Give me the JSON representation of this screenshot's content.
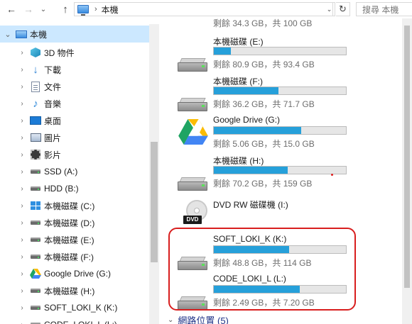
{
  "address": {
    "back_icon": "arrow-left",
    "fwd_icon": "arrow-right",
    "up_icon": "arrow-up",
    "crumb_sep": "›",
    "crumb": "本機",
    "search_placeholder": "搜尋 本機"
  },
  "nav": {
    "items": [
      {
        "label": "本機",
        "icon": "computer-icon",
        "expanded": true,
        "selected": true
      },
      {
        "label": "3D 物件",
        "icon": "3d-objects-icon"
      },
      {
        "label": "下載",
        "icon": "download-icon"
      },
      {
        "label": "文件",
        "icon": "document-icon"
      },
      {
        "label": "音樂",
        "icon": "music-icon"
      },
      {
        "label": "桌面",
        "icon": "desktop-icon"
      },
      {
        "label": "圖片",
        "icon": "pictures-icon"
      },
      {
        "label": "影片",
        "icon": "videos-icon"
      },
      {
        "label": "SSD (A:)",
        "icon": "drive-icon"
      },
      {
        "label": "HDD (B:)",
        "icon": "drive-icon"
      },
      {
        "label": "本機磁碟 (C:)",
        "icon": "windows-drive-icon"
      },
      {
        "label": "本機磁碟 (D:)",
        "icon": "drive-icon"
      },
      {
        "label": "本機磁碟 (E:)",
        "icon": "drive-icon"
      },
      {
        "label": "本機磁碟 (F:)",
        "icon": "drive-icon"
      },
      {
        "label": "Google Drive (G:)",
        "icon": "google-drive-icon"
      },
      {
        "label": "本機磁碟 (H:)",
        "icon": "drive-icon"
      },
      {
        "label": "SOFT_LOKI_K (K:)",
        "icon": "drive-icon"
      },
      {
        "label": "CODE_LOKI_L (L:)",
        "icon": "drive-icon"
      }
    ]
  },
  "drives": {
    "partial_top": {
      "info": "剩餘 34.3 GB，共 100 GB"
    },
    "list": [
      {
        "name": "本機磁碟 (E:)",
        "info": "剩餘 80.9 GB，共 93.4 GB",
        "used_fraction": 0.13,
        "icon": "hard-drive-icon"
      },
      {
        "name": "本機磁碟 (F:)",
        "info": "剩餘 36.2 GB，共 71.7 GB",
        "used_fraction": 0.49,
        "icon": "hard-drive-icon"
      },
      {
        "name": "Google Drive (G:)",
        "info": "剩餘 5.06 GB，共 15.0 GB",
        "used_fraction": 0.66,
        "icon": "google-drive-icon"
      },
      {
        "name": "本機磁碟 (H:)",
        "info": "剩餘 70.2 GB，共 159 GB",
        "used_fraction": 0.56,
        "icon": "hard-drive-icon"
      },
      {
        "name": "DVD RW 磁碟機 (I:)",
        "info": "",
        "icon": "dvd-drive-icon"
      },
      {
        "name": "SOFT_LOKI_K (K:)",
        "info": "剩餘 48.8 GB，共 114 GB",
        "used_fraction": 0.57,
        "icon": "hard-drive-icon"
      },
      {
        "name": "CODE_LOKI_L (L:)",
        "info": "剩餘 2.49 GB，共 7.20 GB",
        "used_fraction": 0.65,
        "icon": "hard-drive-icon"
      }
    ],
    "dvd_label": "DVD"
  },
  "network_group": {
    "label": "網路位置 (5)"
  },
  "colors": {
    "bar_fill": "#26a0da",
    "selection": "#cce8ff",
    "annotation": "#d81e1e"
  }
}
